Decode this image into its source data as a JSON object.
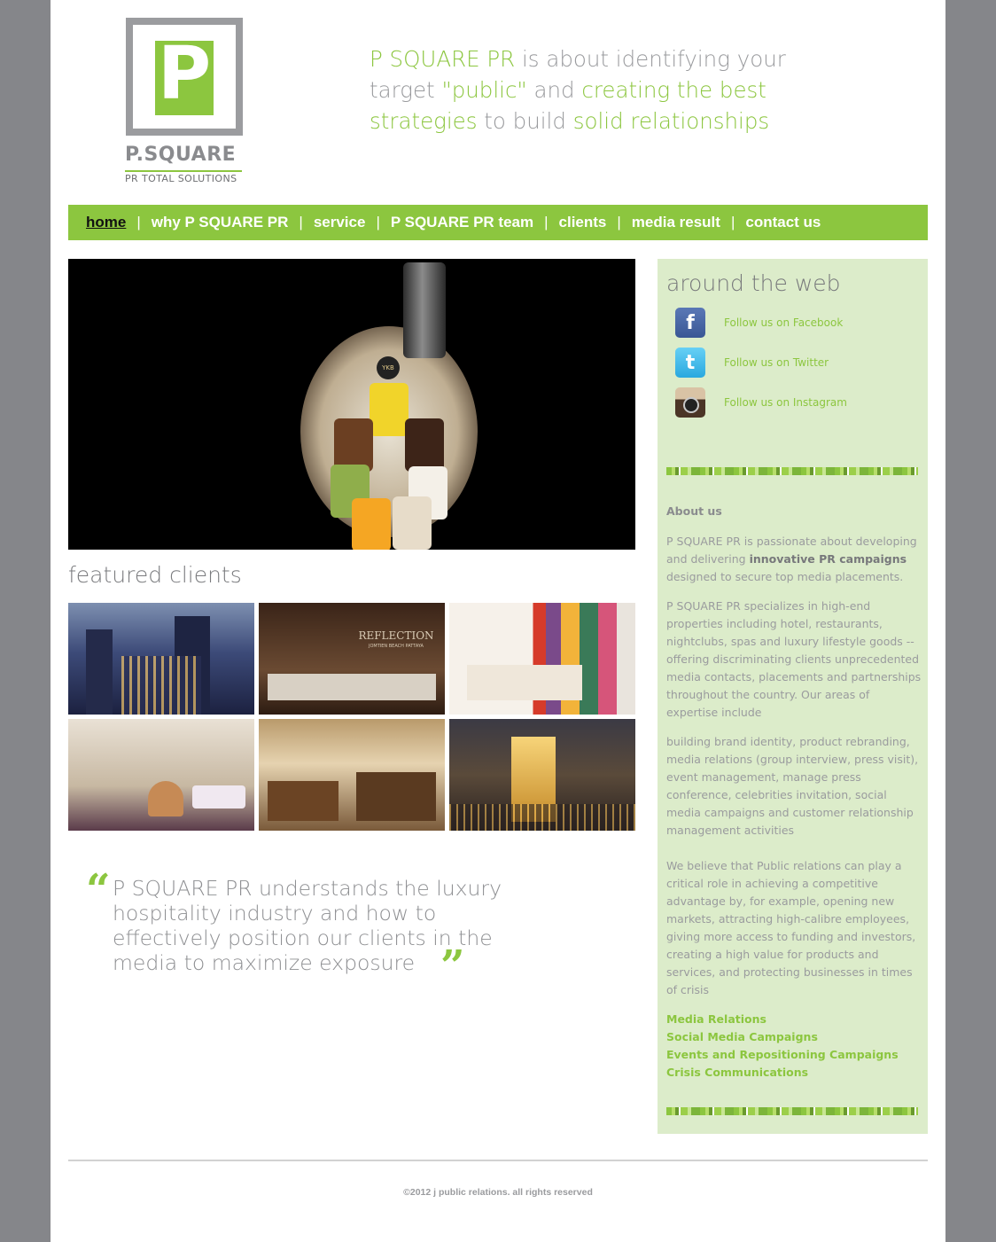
{
  "logo": {
    "letter": "P",
    "name": "P.SQUARE",
    "subtitle": "PR TOTAL SOLUTIONS"
  },
  "tagline": {
    "line1_green": "P SQUARE PR",
    "line1_gray": " is about identifying your",
    "line2_gray_a": "target ",
    "line2_green_a": "\"public\"",
    "line2_gray_b": " and ",
    "line2_green_b": "creating the best",
    "line3_green_a": "strategies",
    "line3_gray": " to build ",
    "line3_green_b": "solid relationships"
  },
  "nav": {
    "items": [
      {
        "label": "home",
        "active": true
      },
      {
        "label": "why P SQUARE PR"
      },
      {
        "label": "service"
      },
      {
        "label": "P SQUARE PR team"
      },
      {
        "label": "clients"
      },
      {
        "label": "media result"
      },
      {
        "label": "contact us"
      }
    ],
    "separator": "|"
  },
  "hero": {
    "plate_label": "YKB"
  },
  "featured": {
    "title": "featured clients",
    "tile_text": [
      "REFLECTION",
      "JOMTIEN BEACH PATTAYA"
    ]
  },
  "quote": {
    "open": "“",
    "text": "P SQUARE PR understands the luxury hospitality industry and how to effectively position our clients in the media to maximize exposure",
    "close": "”"
  },
  "sidebar": {
    "title": "around the web",
    "social": [
      {
        "label": "Follow us on Facebook",
        "icon": "facebook-icon",
        "glyph": "f"
      },
      {
        "label": "Follow us on Twitter",
        "icon": "twitter-icon",
        "glyph": "t"
      },
      {
        "label": "Follow us on Instagram",
        "icon": "instagram-icon",
        "glyph": ""
      }
    ],
    "about_heading": "About us",
    "para1_a": "P SQUARE PR is passionate about developing and delivering ",
    "para1_bold": "innovative PR campaigns",
    "para1_b": " designed to secure top media placements.",
    "para2": "P SQUARE PR specializes in high-end properties including hotel, restaurants, nightclubs, spas and luxury lifestyle goods -- offering discriminating clients unprecedented media contacts, placements and partnerships throughout the country. Our areas of expertise include",
    "para3": "building brand identity, product rebranding, media relations (group interview, press visit), event management, manage press conference, celebrities invitation, social media campaigns and customer relationship management activities",
    "para4": "We believe that Public relations can play a critical role in achieving a competitive advantage by, for example, opening new markets, attracting high-calibre employees, giving more access to funding and investors, creating a high value for products and services, and protecting businesses in times of crisis",
    "links": [
      "Media Relations",
      "Social Media Campaigns",
      "Events and Repositioning Campaigns",
      "Crisis Communications"
    ]
  },
  "footer": {
    "copyright": "©2012 j public relations. all rights reserved"
  },
  "colors": {
    "accent_green": "#8cc63f",
    "sidebar_bg": "#dcecca",
    "outer_bg": "#85868a",
    "text_gray": "#9a9b9e"
  }
}
